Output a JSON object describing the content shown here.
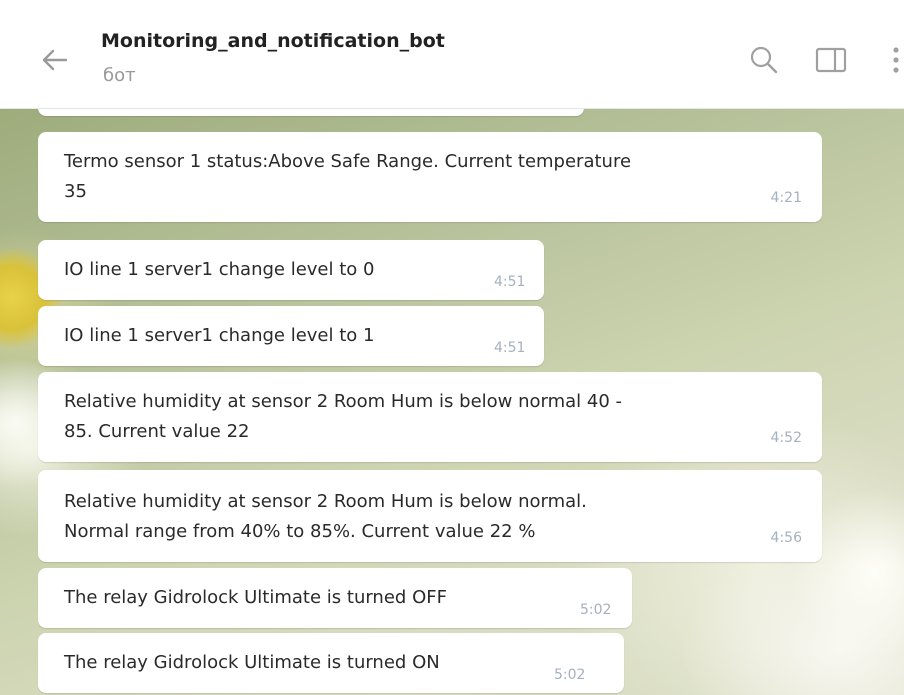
{
  "header": {
    "title": "Monitoring_and_notification_bot",
    "subtitle": "бот"
  },
  "messages": [
    {
      "lines": [
        "Termo sensor 1 status:Above Safe Range. Current temperature",
        "35"
      ],
      "time": "4:21"
    },
    {
      "lines": [
        "IO line 1 server1 change level to 0"
      ],
      "time": "4:51"
    },
    {
      "lines": [
        "IO line 1 server1 change level to 1"
      ],
      "time": "4:51"
    },
    {
      "lines": [
        "Relative humidity at sensor 2 Room Hum is below normal 40 -",
        "85. Current value 22"
      ],
      "time": "4:52"
    },
    {
      "lines": [
        "Relative humidity at sensor 2 Room Hum is below normal.",
        "Normal range from 40% to 85%. Current value 22 %"
      ],
      "time": "4:56"
    },
    {
      "lines": [
        "The relay Gidrolock Ultimate is turned OFF"
      ],
      "time": "5:02"
    },
    {
      "lines": [
        "The relay Gidrolock Ultimate is turned ON"
      ],
      "time": "5:02"
    }
  ],
  "icons": {
    "back": "arrow-left-icon",
    "search": "search-icon",
    "panel": "side-panel-icon",
    "more": "more-vertical-icon"
  },
  "colors": {
    "bubble": "#ffffff",
    "time": "#a4b1bf",
    "title": "#222222",
    "subtitle": "#999999"
  }
}
